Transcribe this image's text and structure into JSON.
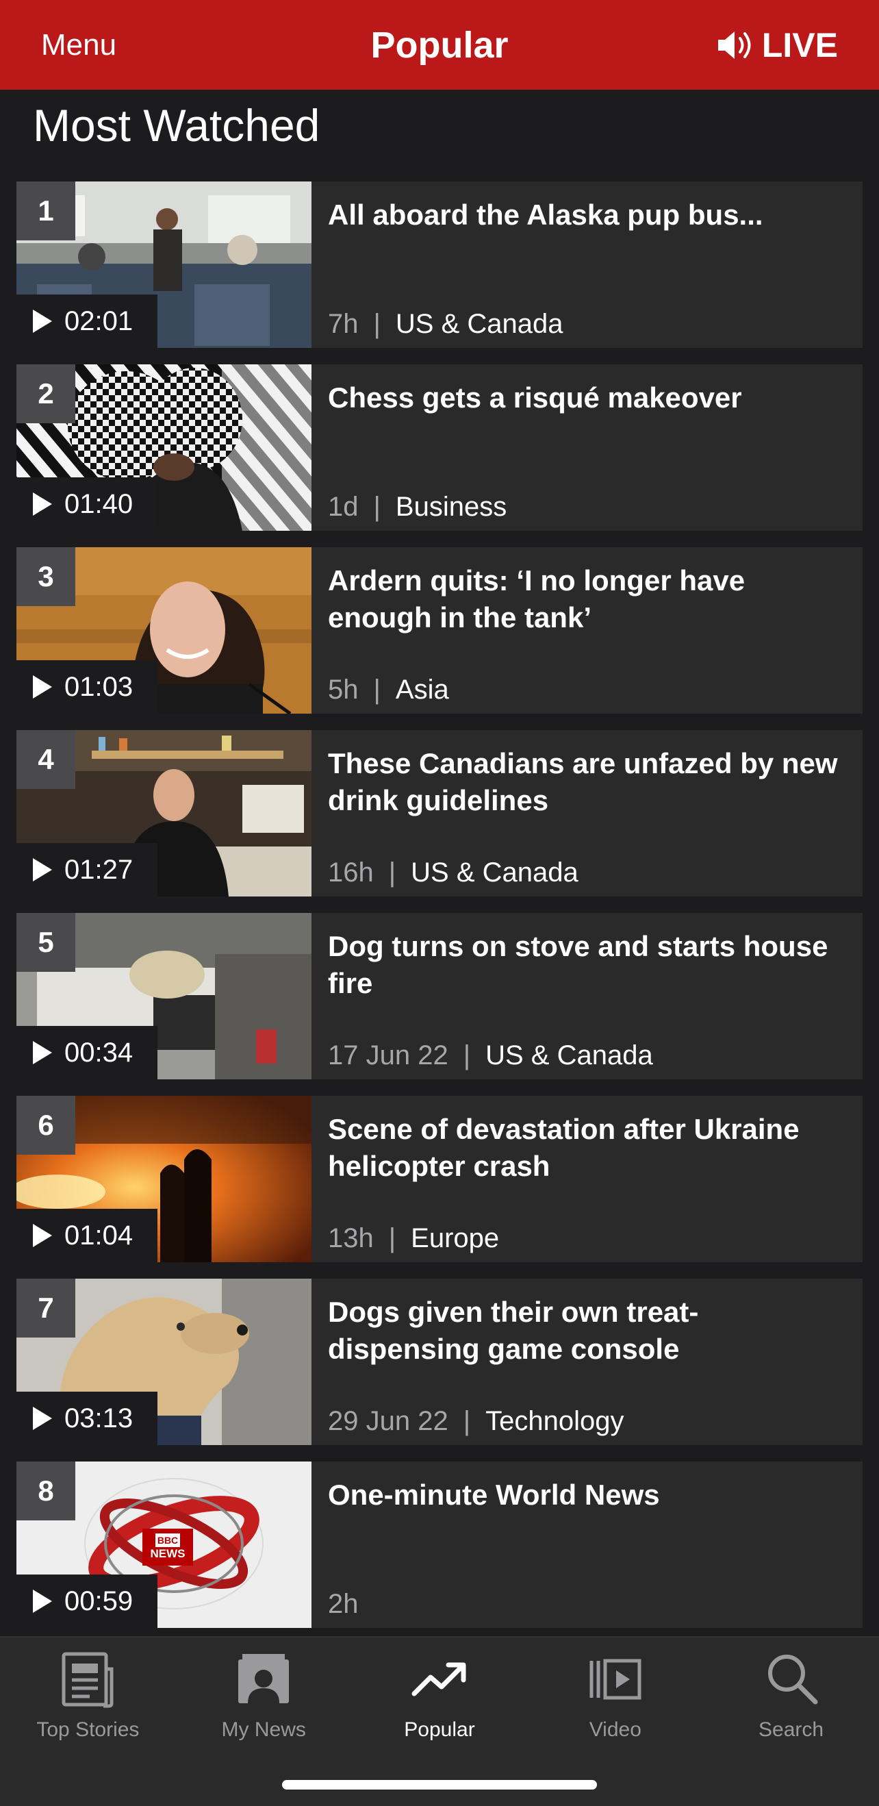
{
  "header": {
    "menu_label": "Menu",
    "title": "Popular",
    "live_label": "LIVE"
  },
  "section_title": "Most Watched",
  "items": [
    {
      "rank": "1",
      "duration": "02:01",
      "headline": "All aboard the Alaska pup bus...",
      "time": "7h",
      "category": "US & Canada"
    },
    {
      "rank": "2",
      "duration": "01:40",
      "headline": "Chess gets a risqué makeover",
      "time": "1d",
      "category": "Business"
    },
    {
      "rank": "3",
      "duration": "01:03",
      "headline": "Ardern quits: ‘I no longer have enough in the tank’",
      "time": "5h",
      "category": "Asia"
    },
    {
      "rank": "4",
      "duration": "01:27",
      "headline": "These Canadians are unfazed by new drink guidelines",
      "time": "16h",
      "category": "US & Canada"
    },
    {
      "rank": "5",
      "duration": "00:34",
      "headline": "Dog turns on stove and starts house fire",
      "time": "17 Jun 22",
      "category": "US & Canada"
    },
    {
      "rank": "6",
      "duration": "01:04",
      "headline": "Scene of devastation after Ukraine helicopter crash",
      "time": "13h",
      "category": "Europe"
    },
    {
      "rank": "7",
      "duration": "03:13",
      "headline": "Dogs given their own treat-dispensing game console",
      "time": "29 Jun 22",
      "category": "Technology"
    },
    {
      "rank": "8",
      "duration": "00:59",
      "headline": "One-minute World News",
      "time": "2h",
      "category": "",
      "logo_text_top": "BBC",
      "logo_text_bottom": "NEWS"
    }
  ],
  "tabs": [
    {
      "label": "Top Stories",
      "icon": "newspaper-icon"
    },
    {
      "label": "My News",
      "icon": "person-news-icon"
    },
    {
      "label": "Popular",
      "icon": "trending-icon",
      "active": true
    },
    {
      "label": "Video",
      "icon": "video-icon"
    },
    {
      "label": "Search",
      "icon": "search-icon"
    }
  ],
  "colors": {
    "brand_red": "#bb1919",
    "background": "#1c1c1e",
    "card": "#2a2a2b"
  }
}
